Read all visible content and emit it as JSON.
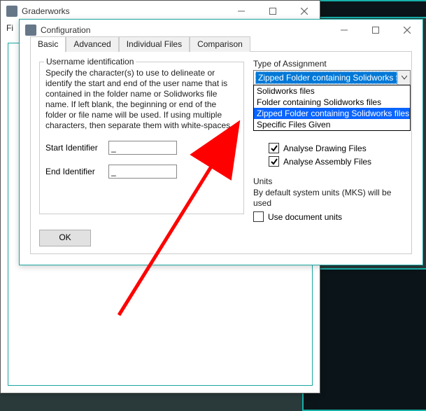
{
  "grader": {
    "title": "Graderworks",
    "menu_file": "Fi"
  },
  "cfg": {
    "title": "Configuration",
    "tabs": [
      "Basic",
      "Advanced",
      "Individual Files",
      "Comparison"
    ],
    "username_group": {
      "legend": "Username identification",
      "desc": "Specify the character(s) to use to delineate or identify the start and end of the user name that is contained in the folder name or Solidworks file name. If left blank, the beginning or end of the folder or file name will be used. If using multiple characters, then separate them with white-spaces.",
      "start_label": "Start Identifier",
      "end_label": "End Identifier",
      "start_value": "_",
      "end_value": "_"
    },
    "assignment": {
      "legend": "Type of Assignment",
      "selected": "Zipped Folder containing Solidworks files",
      "options": [
        "Solidworks files",
        "Folder containing Solidworks files",
        "Zipped Folder containing Solidworks files",
        "Specific Files Given"
      ],
      "analyse_drawing": "Analyse Drawing Files",
      "analyse_assembly": "Analyse Assembly Files"
    },
    "units": {
      "legend": "Units",
      "desc": "By default system units (MKS) will be used",
      "use_doc": "Use document units"
    },
    "ok": "OK"
  }
}
